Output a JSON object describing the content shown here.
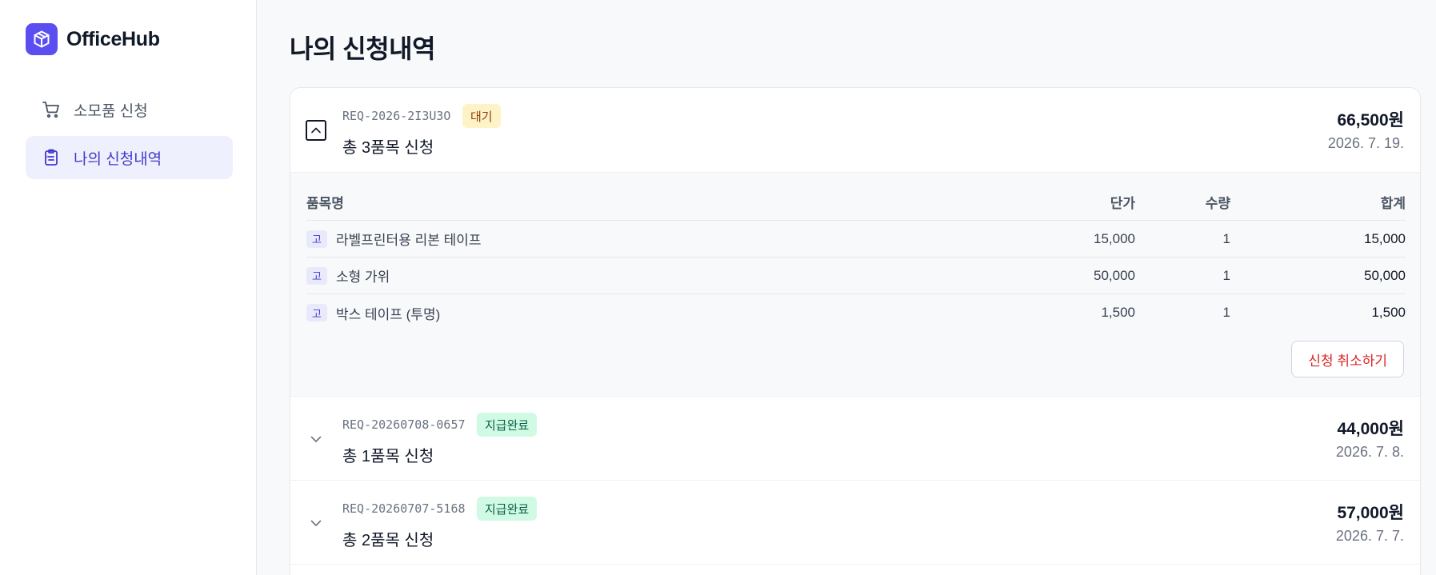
{
  "brand": {
    "name": "OfficeHub",
    "logo_icon": "box-icon",
    "accent": "#5b4ef1"
  },
  "nav": [
    {
      "label": "소모품 신청",
      "icon": "cart-icon",
      "active": false
    },
    {
      "label": "나의 신청내역",
      "icon": "clipboard-icon",
      "active": true
    }
  ],
  "page": {
    "title": "나의 신청내역"
  },
  "requests": [
    {
      "code": "REQ-2026-2I3U3O",
      "status": "대기",
      "summary": "총 3품목 신청",
      "amount": "66,500원",
      "date": "2026. 7. 19.",
      "expanded": true,
      "columns": {
        "name": "품목명",
        "price": "단가",
        "qty": "수량",
        "total": "합계"
      },
      "items": [
        {
          "tag": "고",
          "name": "라벨프린터용 리본 테이프",
          "price": "15,000",
          "qty": "1",
          "total": "15,000"
        },
        {
          "tag": "고",
          "name": "소형 가위",
          "price": "50,000",
          "qty": "1",
          "total": "50,000"
        },
        {
          "tag": "고",
          "name": "박스 테이프 (투명)",
          "price": "1,500",
          "qty": "1",
          "total": "1,500"
        }
      ],
      "cancel_label": "신청 취소하기"
    },
    {
      "code": "REQ-20260708-0657",
      "status": "지급완료",
      "summary": "총 1품목 신청",
      "amount": "44,000원",
      "date": "2026. 7. 8.",
      "expanded": false
    },
    {
      "code": "REQ-20260707-5168",
      "status": "지급완료",
      "summary": "총 2품목 신청",
      "amount": "57,000원",
      "date": "2026. 7. 7.",
      "expanded": false
    }
  ],
  "colors": {
    "pending_bg": "#fef3c7",
    "done_bg": "#d1fae5",
    "danger": "#dc2626",
    "active_nav_bg": "#eef1fd"
  }
}
